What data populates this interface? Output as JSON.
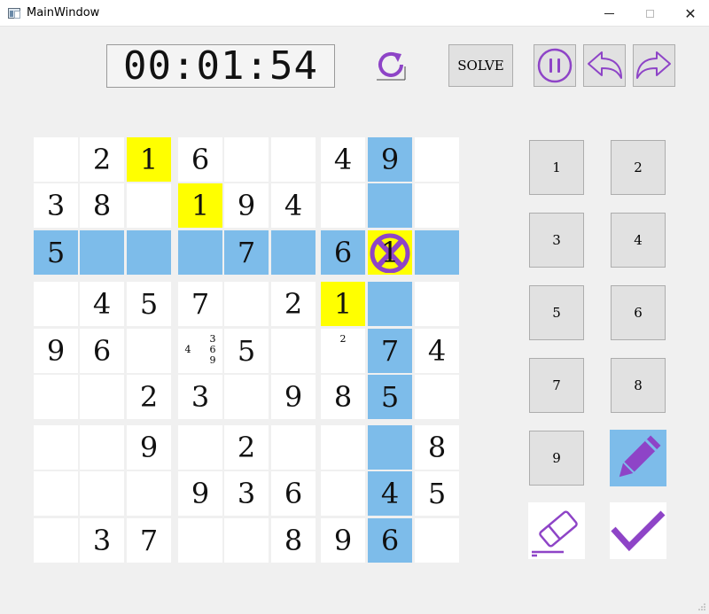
{
  "window": {
    "title": "MainWindow",
    "minimize_glyph": "",
    "maximize_glyph": "",
    "close_glyph": "✕"
  },
  "toolbar": {
    "timer": "00:01:54",
    "solve_label": "SOLVE",
    "icons": {
      "reset": "refresh-icon",
      "pause": "pause-icon",
      "undo": "undo-arrow-icon",
      "redo": "redo-arrow-icon"
    }
  },
  "colors": {
    "accent": "#8e44c7",
    "highlight": "#7dbcea",
    "same_number": "#ffff00",
    "cell_bg": "#ffffff",
    "button_bg": "#e1e1e1",
    "window_bg": "#f0f0f0"
  },
  "board": {
    "selected": {
      "row": 2,
      "col": 7
    },
    "highlight_row": 2,
    "highlight_col": 7,
    "same_number_cells": [
      [
        0,
        2
      ],
      [
        1,
        3
      ],
      [
        3,
        6
      ]
    ],
    "rows": [
      [
        "",
        "2",
        "1",
        "6",
        "",
        "",
        "4",
        "9",
        ""
      ],
      [
        "3",
        "8",
        "",
        "1",
        "9",
        "4",
        "",
        "",
        ""
      ],
      [
        "5",
        "",
        "",
        "",
        "7",
        "",
        "6",
        "1",
        ""
      ],
      [
        "",
        "4",
        "5",
        "7",
        "",
        "2",
        "1",
        "",
        ""
      ],
      [
        "9",
        "6",
        "",
        "",
        "5",
        "",
        "",
        "7",
        "4"
      ],
      [
        "",
        "",
        "2",
        "3",
        "",
        "9",
        "8",
        "5",
        ""
      ],
      [
        "",
        "",
        "9",
        "",
        "2",
        "",
        "",
        "",
        "8"
      ],
      [
        "",
        "",
        "",
        "9",
        "3",
        "6",
        "",
        "4",
        "5"
      ],
      [
        "",
        "3",
        "7",
        "",
        "",
        "8",
        "9",
        "6",
        ""
      ]
    ],
    "notes": [
      {
        "row": 4,
        "col": 3,
        "digits": [
          "3",
          "4",
          "6",
          "9"
        ]
      },
      {
        "row": 4,
        "col": 6,
        "digits": [
          "2"
        ]
      }
    ]
  },
  "numpad": {
    "labels": [
      "1",
      "2",
      "3",
      "4",
      "5",
      "6",
      "7",
      "8",
      "9"
    ],
    "pencil_icon": "pencil-icon",
    "eraser_icon": "eraser-icon",
    "check_icon": "checkmark-icon"
  }
}
